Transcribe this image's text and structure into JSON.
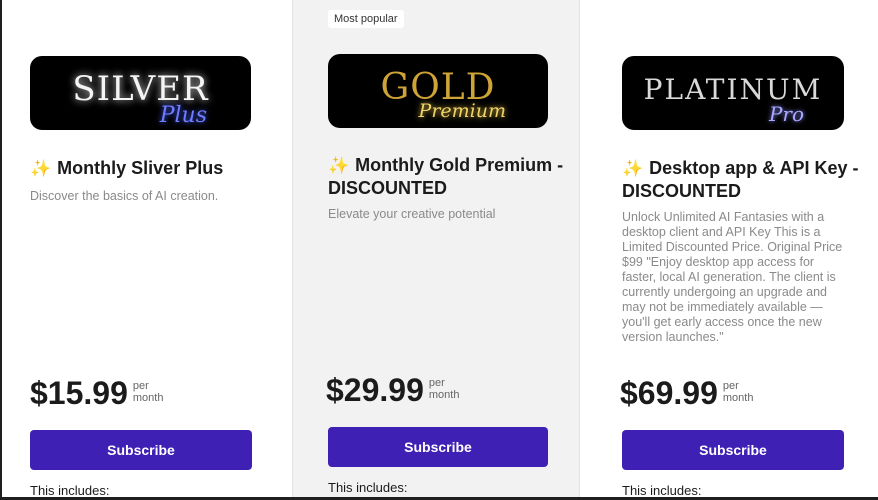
{
  "colors": {
    "subscribe_button": "#3e21b4",
    "popular_column_bg": "#f2f2f2",
    "sparkle_icon": "#f5b83b"
  },
  "plans": [
    {
      "banner_big": "SILVER",
      "banner_script": "Plus",
      "sparkle_icon": "sparkles-icon",
      "title": "Monthly Sliver Plus",
      "description": "Discover the basics of AI creation.",
      "price": "$15.99",
      "per_line1": "per",
      "per_line2": "month",
      "button_label": "Subscribe",
      "includes_label": "This includes:"
    },
    {
      "badge": "Most popular",
      "banner_big": "GOLD",
      "banner_script": "Premium",
      "sparkle_icon": "sparkles-icon",
      "title": "Monthly Gold Premium -DISCOUNTED",
      "description": "Elevate your creative potential",
      "price": "$29.99",
      "per_line1": "per",
      "per_line2": "month",
      "button_label": "Subscribe",
      "includes_label": "This includes:"
    },
    {
      "banner_big": "PLATINUM",
      "banner_script": "Pro",
      "sparkle_icon": "sparkles-icon",
      "title": "Desktop app & API Key -DISCOUNTED",
      "description": "Unlock Unlimited AI Fantasies with a desktop client and API Key This is a Limited Discounted Price. Original Price $99 \"Enjoy desktop app access for faster, local AI generation. The client is currently undergoing an upgrade and may not be immediately available — you'll get early access once the new version launches.\"",
      "price": "$69.99",
      "per_line1": "per",
      "per_line2": "month",
      "button_label": "Subscribe",
      "includes_label": "This includes:"
    }
  ]
}
